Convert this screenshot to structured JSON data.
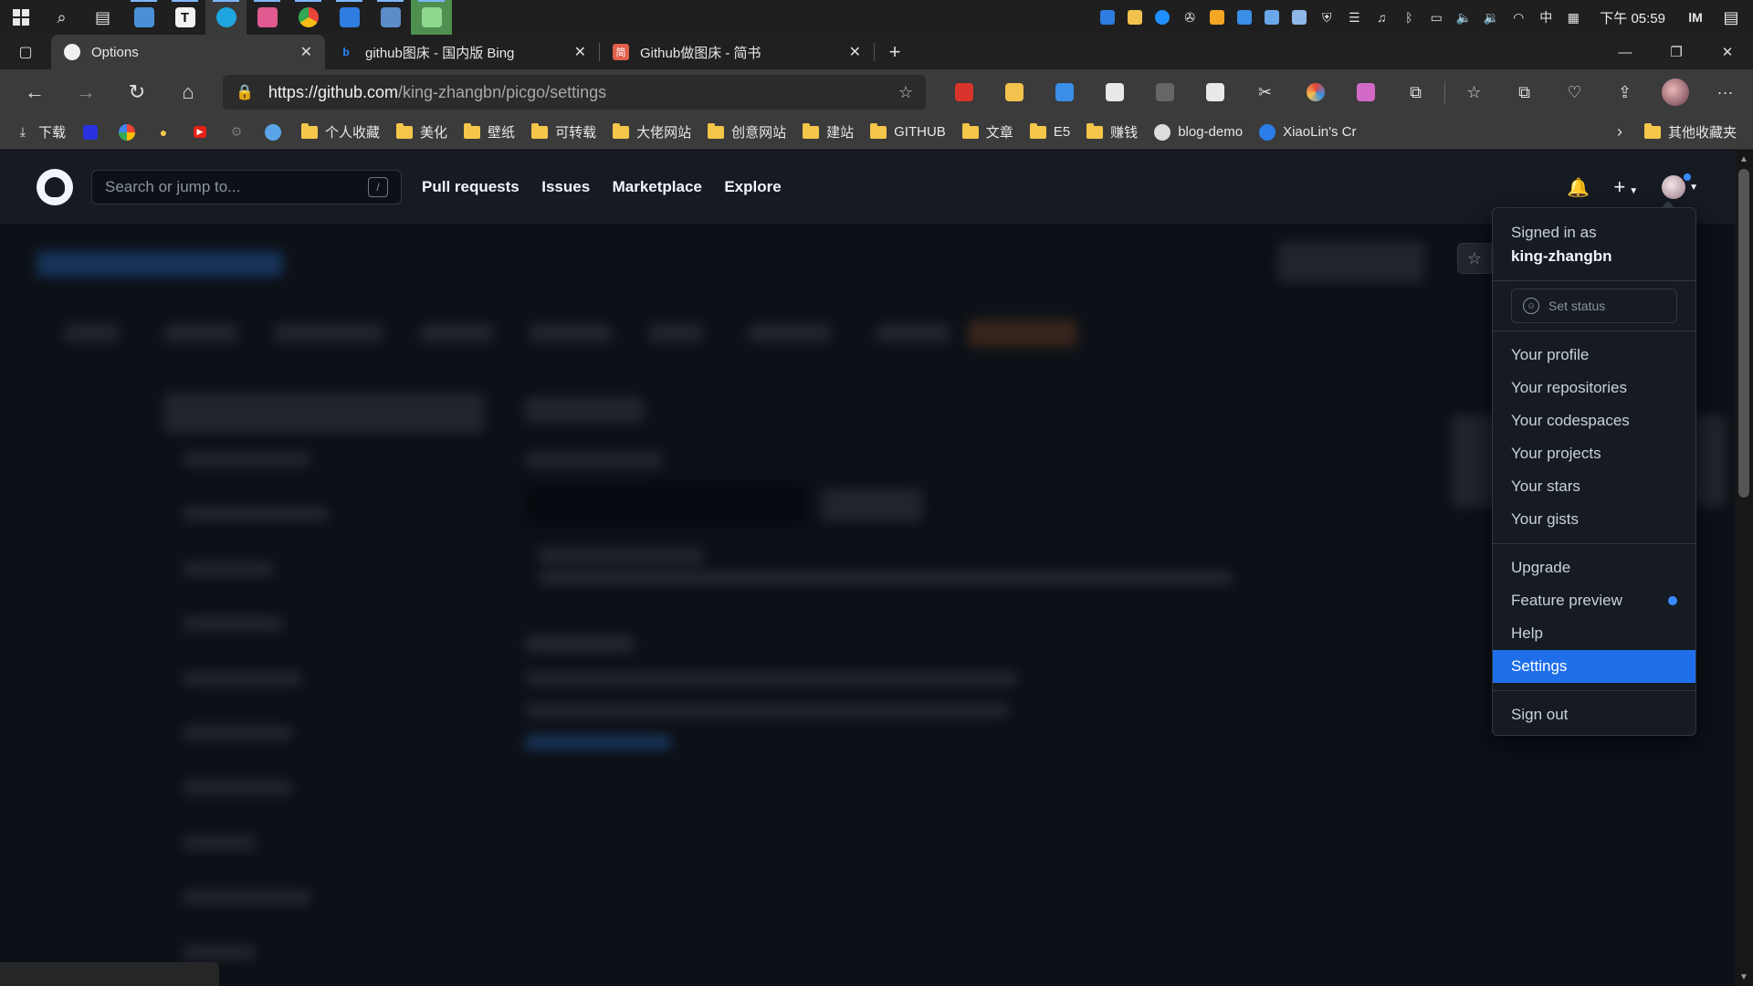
{
  "taskbar": {
    "clock": "下午 05:59",
    "tray_text": "中",
    "apps": [
      {
        "name": "start",
        "color": "#3d8ee6"
      },
      {
        "name": "search",
        "color": ""
      },
      {
        "name": "task-view",
        "color": ""
      },
      {
        "name": "app-blue",
        "color": "#4a90d9"
      },
      {
        "name": "typora",
        "color": "#f2f2f2"
      },
      {
        "name": "edge",
        "color": "#1fa6e0"
      },
      {
        "name": "app-pink",
        "color": "#e05a90"
      },
      {
        "name": "chrome",
        "color": "#e8453c"
      },
      {
        "name": "app-star",
        "color": "#2f7de1"
      },
      {
        "name": "app-remote",
        "color": "#5b8dc9"
      },
      {
        "name": "app-green",
        "color": "#5cb85c"
      }
    ]
  },
  "browser": {
    "tabs": [
      {
        "title": "Options",
        "favicon": "github-icon",
        "active": true
      },
      {
        "title": "github图床 - 国内版 Bing",
        "favicon": "bing-icon",
        "active": false
      },
      {
        "title": "Github做图床 - 简书",
        "favicon": "jianshu-icon",
        "active": false
      }
    ],
    "url_host": "https://github.com",
    "url_path": "/king-zhangbn/picgo/settings",
    "bookmarks": [
      {
        "label": "下载",
        "icon": "download-icon"
      },
      {
        "label": "",
        "icon": "baidu-icon"
      },
      {
        "label": "",
        "icon": "google-icon"
      },
      {
        "label": "",
        "icon": "bulb-icon"
      },
      {
        "label": "",
        "icon": "youtube-icon"
      },
      {
        "label": "",
        "icon": "gear-icon"
      },
      {
        "label": "",
        "icon": "cloud-icon"
      },
      {
        "label": "个人收藏",
        "icon": "folder-icon"
      },
      {
        "label": "美化",
        "icon": "folder-icon"
      },
      {
        "label": "壁纸",
        "icon": "folder-icon"
      },
      {
        "label": "可转载",
        "icon": "folder-icon"
      },
      {
        "label": "大佬网站",
        "icon": "folder-icon"
      },
      {
        "label": "创意网站",
        "icon": "folder-icon"
      },
      {
        "label": "建站",
        "icon": "folder-icon"
      },
      {
        "label": "GITHUB",
        "icon": "folder-icon"
      },
      {
        "label": "文章",
        "icon": "folder-icon"
      },
      {
        "label": "E5",
        "icon": "folder-icon"
      },
      {
        "label": "赚钱",
        "icon": "folder-icon"
      },
      {
        "label": "blog-demo",
        "icon": "avatar-icon"
      },
      {
        "label": "XiaoLin's Cr",
        "icon": "globe-icon"
      }
    ],
    "other_bookmarks": "其他收藏夹"
  },
  "github": {
    "search_placeholder": "Search or jump to...",
    "search_shortcut": "/",
    "nav": [
      "Pull requests",
      "Issues",
      "Marketplace",
      "Explore"
    ],
    "dropdown": {
      "signed_in_as": "Signed in as",
      "username": "king-zhangbn",
      "set_status": "Set status",
      "group1": [
        "Your profile",
        "Your repositories",
        "Your codespaces",
        "Your projects",
        "Your stars",
        "Your gists"
      ],
      "group2": [
        "Upgrade",
        "Feature preview",
        "Help",
        "Settings"
      ],
      "selected": "Settings",
      "sign_out": "Sign out"
    }
  },
  "colors": {
    "accent": "#1f6feb",
    "dot": "#388bfd",
    "page_bg": "#0d1117",
    "header_bg": "#161b22"
  }
}
